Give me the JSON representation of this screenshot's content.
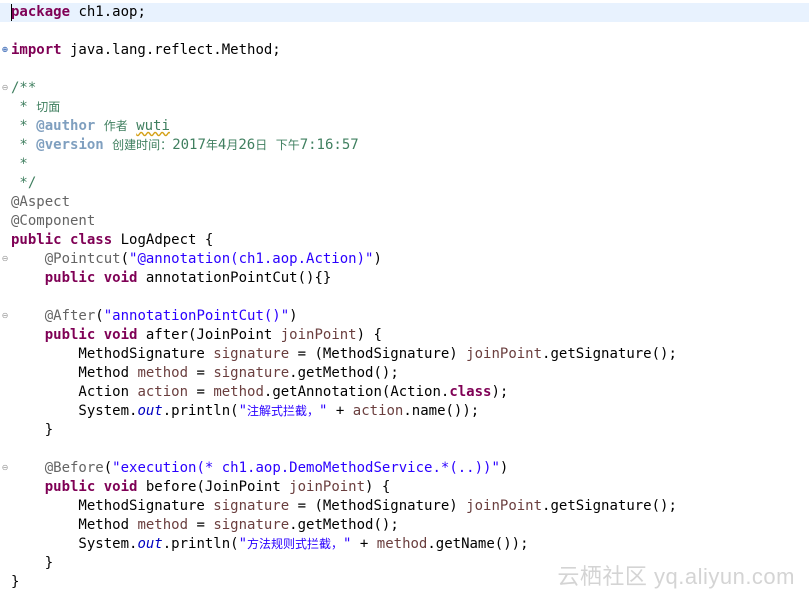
{
  "editor": {
    "lines": [
      {
        "tokens": [
          {
            "t": "kw",
            "v": "package"
          },
          {
            "t": "plain",
            "v": " ch1.aop;"
          }
        ],
        "current": true
      },
      {
        "tokens": []
      },
      {
        "fold": "plus",
        "tokens": [
          {
            "t": "kw",
            "v": "import"
          },
          {
            "t": "plain",
            "v": " java.lang.reflect.Method;"
          }
        ]
      },
      {
        "tokens": []
      },
      {
        "fold": "minus",
        "tokens": [
          {
            "t": "cmt",
            "v": "/**"
          }
        ]
      },
      {
        "tokens": [
          {
            "t": "cmt",
            "v": " * 切面"
          }
        ]
      },
      {
        "tokens": [
          {
            "t": "cmt",
            "v": " * "
          },
          {
            "t": "jdt",
            "v": "@author"
          },
          {
            "t": "cmt",
            "v": " 作者 "
          },
          {
            "t": "cmt",
            "cls": "spell",
            "v": "wuti"
          }
        ]
      },
      {
        "tokens": [
          {
            "t": "cmt",
            "v": " * "
          },
          {
            "t": "jdt",
            "v": "@version"
          },
          {
            "t": "cmt",
            "v": " 创建时间：2017年4月26日 下午7:16:57"
          }
        ]
      },
      {
        "tokens": [
          {
            "t": "cmt",
            "v": " *"
          }
        ]
      },
      {
        "tokens": [
          {
            "t": "cmt",
            "v": " */"
          }
        ]
      },
      {
        "tokens": [
          {
            "t": "ann",
            "v": "@Aspect"
          }
        ]
      },
      {
        "tokens": [
          {
            "t": "ann",
            "v": "@Component"
          }
        ]
      },
      {
        "tokens": [
          {
            "t": "kw",
            "v": "public"
          },
          {
            "t": "plain",
            "v": " "
          },
          {
            "t": "kw",
            "v": "class"
          },
          {
            "t": "plain",
            "v": " LogAdpect {"
          }
        ]
      },
      {
        "fold": "minus",
        "tokens": [
          {
            "t": "plain",
            "v": "    "
          },
          {
            "t": "ann",
            "v": "@Pointcut"
          },
          {
            "t": "plain",
            "v": "("
          },
          {
            "t": "str",
            "v": "\"@annotation(ch1.aop.Action)\""
          },
          {
            "t": "plain",
            "v": ")"
          }
        ]
      },
      {
        "tokens": [
          {
            "t": "plain",
            "v": "    "
          },
          {
            "t": "kw",
            "v": "public"
          },
          {
            "t": "plain",
            "v": " "
          },
          {
            "t": "kw",
            "v": "void"
          },
          {
            "t": "plain",
            "v": " annotationPointCut(){}"
          }
        ]
      },
      {
        "tokens": []
      },
      {
        "fold": "minus",
        "tokens": [
          {
            "t": "plain",
            "v": "    "
          },
          {
            "t": "ann",
            "v": "@After"
          },
          {
            "t": "plain",
            "v": "("
          },
          {
            "t": "str",
            "v": "\"annotationPointCut()\""
          },
          {
            "t": "plain",
            "v": ")"
          }
        ]
      },
      {
        "tokens": [
          {
            "t": "plain",
            "v": "    "
          },
          {
            "t": "kw",
            "v": "public"
          },
          {
            "t": "plain",
            "v": " "
          },
          {
            "t": "kw",
            "v": "void"
          },
          {
            "t": "plain",
            "v": " after(JoinPoint "
          },
          {
            "t": "par",
            "v": "joinPoint"
          },
          {
            "t": "plain",
            "v": ") {"
          }
        ]
      },
      {
        "tokens": [
          {
            "t": "plain",
            "v": "        MethodSignature "
          },
          {
            "t": "var",
            "v": "signature"
          },
          {
            "t": "plain",
            "v": " = (MethodSignature) "
          },
          {
            "t": "par",
            "v": "joinPoint"
          },
          {
            "t": "plain",
            "v": ".getSignature();"
          }
        ]
      },
      {
        "tokens": [
          {
            "t": "plain",
            "v": "        Method "
          },
          {
            "t": "var",
            "v": "method"
          },
          {
            "t": "plain",
            "v": " = "
          },
          {
            "t": "var",
            "v": "signature"
          },
          {
            "t": "plain",
            "v": ".getMethod();"
          }
        ]
      },
      {
        "tokens": [
          {
            "t": "plain",
            "v": "        Action "
          },
          {
            "t": "var",
            "v": "action"
          },
          {
            "t": "plain",
            "v": " = "
          },
          {
            "t": "var",
            "v": "method"
          },
          {
            "t": "plain",
            "v": ".getAnnotation(Action."
          },
          {
            "t": "kw",
            "v": "class"
          },
          {
            "t": "plain",
            "v": ");"
          }
        ]
      },
      {
        "tokens": [
          {
            "t": "plain",
            "v": "        System."
          },
          {
            "t": "sfld",
            "v": "out"
          },
          {
            "t": "plain",
            "v": ".println("
          },
          {
            "t": "str",
            "v": "\"注解式拦截，\""
          },
          {
            "t": "plain",
            "v": " + "
          },
          {
            "t": "var",
            "v": "action"
          },
          {
            "t": "plain",
            "v": ".name());"
          }
        ]
      },
      {
        "tokens": [
          {
            "t": "plain",
            "v": "    }"
          }
        ]
      },
      {
        "tokens": []
      },
      {
        "fold": "minus",
        "tokens": [
          {
            "t": "plain",
            "v": "    "
          },
          {
            "t": "ann",
            "v": "@Before"
          },
          {
            "t": "plain",
            "v": "("
          },
          {
            "t": "str",
            "v": "\"execution(* ch1.aop.DemoMethodService.*(..))\""
          },
          {
            "t": "plain",
            "v": ")"
          }
        ]
      },
      {
        "tokens": [
          {
            "t": "plain",
            "v": "    "
          },
          {
            "t": "kw",
            "v": "public"
          },
          {
            "t": "plain",
            "v": " "
          },
          {
            "t": "kw",
            "v": "void"
          },
          {
            "t": "plain",
            "v": " before(JoinPoint "
          },
          {
            "t": "par",
            "v": "joinPoint"
          },
          {
            "t": "plain",
            "v": ") {"
          }
        ]
      },
      {
        "tokens": [
          {
            "t": "plain",
            "v": "        MethodSignature "
          },
          {
            "t": "var",
            "v": "signature"
          },
          {
            "t": "plain",
            "v": " = (MethodSignature) "
          },
          {
            "t": "par",
            "v": "joinPoint"
          },
          {
            "t": "plain",
            "v": ".getSignature();"
          }
        ]
      },
      {
        "tokens": [
          {
            "t": "plain",
            "v": "        Method "
          },
          {
            "t": "var",
            "v": "method"
          },
          {
            "t": "plain",
            "v": " = "
          },
          {
            "t": "var",
            "v": "signature"
          },
          {
            "t": "plain",
            "v": ".getMethod();"
          }
        ]
      },
      {
        "tokens": [
          {
            "t": "plain",
            "v": "        System."
          },
          {
            "t": "sfld",
            "v": "out"
          },
          {
            "t": "plain",
            "v": ".println("
          },
          {
            "t": "str",
            "v": "\"方法规则式拦截，\""
          },
          {
            "t": "plain",
            "v": " + "
          },
          {
            "t": "var",
            "v": "method"
          },
          {
            "t": "plain",
            "v": ".getName());"
          }
        ]
      },
      {
        "tokens": [
          {
            "t": "plain",
            "v": "    }"
          }
        ]
      },
      {
        "tokens": [
          {
            "t": "plain",
            "v": "}"
          }
        ]
      }
    ]
  },
  "watermark": {
    "text": "云栖社区 yq.aliyun.com"
  },
  "colors": {
    "keyword": "#7f0055",
    "string": "#2a00ff",
    "comment": "#3f7f5f",
    "javadoc_tag": "#7f9fbf",
    "annotation": "#646464",
    "field": "#0000c0",
    "local_variable": "#6a3e3e",
    "current_line": "#e8f2fe",
    "background": "#ffffff"
  }
}
